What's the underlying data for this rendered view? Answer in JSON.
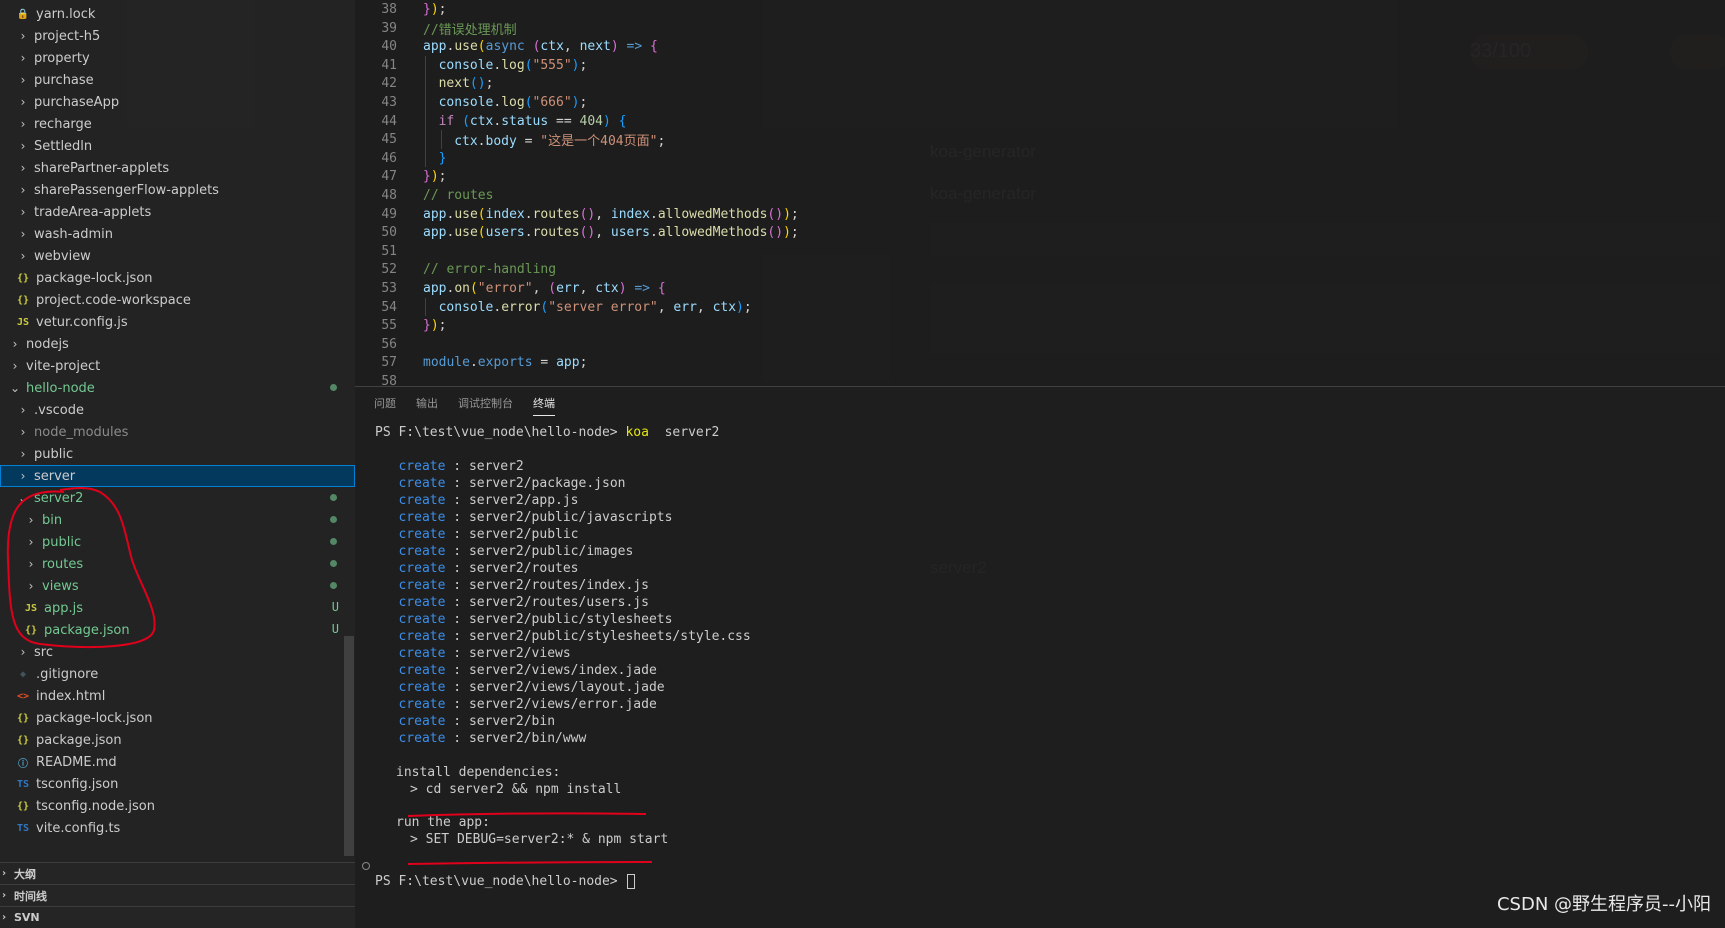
{
  "explorer": {
    "items": [
      {
        "label": "yarn.lock",
        "indent": 1,
        "kind": "file",
        "icon": "lock-file-icon",
        "glyph": "🔒",
        "cls": "",
        "status": ""
      },
      {
        "label": "project-h5",
        "indent": 1,
        "kind": "folder",
        "cls": "",
        "status": ""
      },
      {
        "label": "property",
        "indent": 1,
        "kind": "folder",
        "cls": "",
        "status": ""
      },
      {
        "label": "purchase",
        "indent": 1,
        "kind": "folder",
        "cls": "",
        "status": ""
      },
      {
        "label": "purchaseApp",
        "indent": 1,
        "kind": "folder",
        "cls": "",
        "status": ""
      },
      {
        "label": "recharge",
        "indent": 1,
        "kind": "folder",
        "cls": "",
        "status": ""
      },
      {
        "label": "Settledln",
        "indent": 1,
        "kind": "folder",
        "cls": "",
        "status": ""
      },
      {
        "label": "sharePartner-applets",
        "indent": 1,
        "kind": "folder",
        "cls": "",
        "status": ""
      },
      {
        "label": "sharePassengerFlow-applets",
        "indent": 1,
        "kind": "folder",
        "cls": "",
        "status": ""
      },
      {
        "label": "tradeArea-applets",
        "indent": 1,
        "kind": "folder",
        "cls": "",
        "status": ""
      },
      {
        "label": "wash-admin",
        "indent": 1,
        "kind": "folder",
        "cls": "",
        "status": ""
      },
      {
        "label": "webview",
        "indent": 1,
        "kind": "folder",
        "cls": "",
        "status": ""
      },
      {
        "label": "package-lock.json",
        "indent": 1,
        "kind": "file",
        "icon": "json-file-icon",
        "glyph": "{}",
        "cls": "",
        "status": ""
      },
      {
        "label": "project.code-workspace",
        "indent": 1,
        "kind": "file",
        "icon": "json-file-icon",
        "glyph": "{}",
        "cls": "",
        "status": ""
      },
      {
        "label": "vetur.config.js",
        "indent": 1,
        "kind": "file",
        "icon": "js-file-icon",
        "glyph": "JS",
        "cls": "",
        "status": ""
      },
      {
        "label": "nodejs",
        "indent": 0,
        "kind": "folder",
        "cls": "",
        "status": ""
      },
      {
        "label": "vite-project",
        "indent": 0,
        "kind": "folder",
        "cls": "",
        "status": ""
      },
      {
        "label": "hello-node",
        "indent": 0,
        "kind": "folder-open",
        "cls": "green",
        "status": "dot"
      },
      {
        "label": ".vscode",
        "indent": 1,
        "kind": "folder",
        "cls": "",
        "status": ""
      },
      {
        "label": "node_modules",
        "indent": 1,
        "kind": "folder",
        "cls": "dim",
        "status": ""
      },
      {
        "label": "public",
        "indent": 1,
        "kind": "folder",
        "cls": "",
        "status": ""
      },
      {
        "label": "server",
        "indent": 1,
        "kind": "folder",
        "cls": "selected",
        "status": ""
      },
      {
        "label": "server2",
        "indent": 1,
        "kind": "folder-open",
        "cls": "green",
        "status": "dot"
      },
      {
        "label": "bin",
        "indent": 2,
        "kind": "folder",
        "cls": "green",
        "status": "dot"
      },
      {
        "label": "public",
        "indent": 2,
        "kind": "folder",
        "cls": "green",
        "status": "dot"
      },
      {
        "label": "routes",
        "indent": 2,
        "kind": "folder",
        "cls": "green",
        "status": "dot"
      },
      {
        "label": "views",
        "indent": 2,
        "kind": "folder",
        "cls": "green",
        "status": "dot"
      },
      {
        "label": "app.js",
        "indent": 2,
        "kind": "file",
        "icon": "js-file-icon",
        "glyph": "JS",
        "cls": "green",
        "status": "U"
      },
      {
        "label": "package.json",
        "indent": 2,
        "kind": "file",
        "icon": "json-file-icon",
        "glyph": "{}",
        "cls": "green",
        "status": "U"
      },
      {
        "label": "src",
        "indent": 1,
        "kind": "folder",
        "cls": "",
        "status": ""
      },
      {
        "label": ".gitignore",
        "indent": 1,
        "kind": "file",
        "icon": "git-file-icon",
        "glyph": "◆",
        "cls": "",
        "status": ""
      },
      {
        "label": "index.html",
        "indent": 1,
        "kind": "file",
        "icon": "html-file-icon",
        "glyph": "<>",
        "cls": "",
        "status": ""
      },
      {
        "label": "package-lock.json",
        "indent": 1,
        "kind": "file",
        "icon": "json-file-icon",
        "glyph": "{}",
        "cls": "",
        "status": ""
      },
      {
        "label": "package.json",
        "indent": 1,
        "kind": "file",
        "icon": "json-file-icon",
        "glyph": "{}",
        "cls": "",
        "status": ""
      },
      {
        "label": "README.md",
        "indent": 1,
        "kind": "file",
        "icon": "info-file-icon",
        "glyph": "ⓘ",
        "cls": "",
        "status": ""
      },
      {
        "label": "tsconfig.json",
        "indent": 1,
        "kind": "file",
        "icon": "tsconfig-file-icon",
        "glyph": "TS",
        "cls": "",
        "status": ""
      },
      {
        "label": "tsconfig.node.json",
        "indent": 1,
        "kind": "file",
        "icon": "json-file-icon",
        "glyph": "{}",
        "cls": "",
        "status": ""
      },
      {
        "label": "vite.config.ts",
        "indent": 1,
        "kind": "file",
        "icon": "ts-file-icon",
        "glyph": "TS",
        "cls": "",
        "status": ""
      }
    ],
    "status_untracked": "U",
    "panels": [
      "大纲",
      "时间线",
      "SVN"
    ]
  },
  "editor": {
    "lines": [
      {
        "n": "38",
        "indent": 0,
        "tokens": [
          [
            "tk-br2",
            "}"
          ],
          [
            "tk-br1",
            ")"
          ],
          [
            "tk-pun",
            ";"
          ]
        ]
      },
      {
        "n": "39",
        "indent": 0,
        "tokens": [
          [
            "tk-com",
            "//错误处理机制"
          ]
        ]
      },
      {
        "n": "40",
        "indent": 0,
        "tokens": [
          [
            "tk-var",
            "app"
          ],
          [
            "tk-pun",
            "."
          ],
          [
            "tk-fn",
            "use"
          ],
          [
            "tk-br1",
            "("
          ],
          [
            "tk-kw",
            "async "
          ],
          [
            "tk-br2",
            "("
          ],
          [
            "tk-var",
            "ctx"
          ],
          [
            "tk-pun",
            ", "
          ],
          [
            "tk-var",
            "next"
          ],
          [
            "tk-br2",
            ")"
          ],
          [
            "tk-kw",
            " => "
          ],
          [
            "tk-br2",
            "{"
          ]
        ]
      },
      {
        "n": "41",
        "indent": 1,
        "tokens": [
          [
            "tk-var",
            "console"
          ],
          [
            "tk-pun",
            "."
          ],
          [
            "tk-fn",
            "log"
          ],
          [
            "tk-br3",
            "("
          ],
          [
            "tk-str",
            "\"555\""
          ],
          [
            "tk-br3",
            ")"
          ],
          [
            "tk-pun",
            ";"
          ]
        ]
      },
      {
        "n": "42",
        "indent": 1,
        "tokens": [
          [
            "tk-fn",
            "next"
          ],
          [
            "tk-br3",
            "()"
          ],
          [
            "tk-pun",
            ";"
          ]
        ]
      },
      {
        "n": "43",
        "indent": 1,
        "tokens": [
          [
            "tk-var",
            "console"
          ],
          [
            "tk-pun",
            "."
          ],
          [
            "tk-fn",
            "log"
          ],
          [
            "tk-br3",
            "("
          ],
          [
            "tk-str",
            "\"666\""
          ],
          [
            "tk-br3",
            ")"
          ],
          [
            "tk-pun",
            ";"
          ]
        ]
      },
      {
        "n": "44",
        "indent": 1,
        "tokens": [
          [
            "tk-ctl",
            "if "
          ],
          [
            "tk-br3",
            "("
          ],
          [
            "tk-var",
            "ctx"
          ],
          [
            "tk-pun",
            "."
          ],
          [
            "tk-var",
            "status"
          ],
          [
            "tk-pun",
            " == "
          ],
          [
            "tk-num",
            "404"
          ],
          [
            "tk-br3",
            ")"
          ],
          [
            "tk-pun",
            " "
          ],
          [
            "tk-br3",
            "{"
          ]
        ]
      },
      {
        "n": "45",
        "indent": 2,
        "tokens": [
          [
            "tk-var",
            "ctx"
          ],
          [
            "tk-pun",
            "."
          ],
          [
            "tk-var",
            "body"
          ],
          [
            "tk-pun",
            " = "
          ],
          [
            "tk-str",
            "\"这是一个404页面\""
          ],
          [
            "tk-pun",
            ";"
          ]
        ]
      },
      {
        "n": "46",
        "indent": 1,
        "tokens": [
          [
            "tk-br3",
            "}"
          ]
        ]
      },
      {
        "n": "47",
        "indent": 0,
        "tokens": [
          [
            "tk-br2",
            "}"
          ],
          [
            "tk-br1",
            ")"
          ],
          [
            "tk-pun",
            ";"
          ]
        ]
      },
      {
        "n": "48",
        "indent": 0,
        "tokens": [
          [
            "tk-com",
            "// routes"
          ]
        ]
      },
      {
        "n": "49",
        "indent": 0,
        "tokens": [
          [
            "tk-var",
            "app"
          ],
          [
            "tk-pun",
            "."
          ],
          [
            "tk-fn",
            "use"
          ],
          [
            "tk-br1",
            "("
          ],
          [
            "tk-var",
            "index"
          ],
          [
            "tk-pun",
            "."
          ],
          [
            "tk-fn",
            "routes"
          ],
          [
            "tk-br2",
            "()"
          ],
          [
            "tk-pun",
            ", "
          ],
          [
            "tk-var",
            "index"
          ],
          [
            "tk-pun",
            "."
          ],
          [
            "tk-fn",
            "allowedMethods"
          ],
          [
            "tk-br2",
            "()"
          ],
          [
            "tk-br1",
            ")"
          ],
          [
            "tk-pun",
            ";"
          ]
        ]
      },
      {
        "n": "50",
        "indent": 0,
        "tokens": [
          [
            "tk-var",
            "app"
          ],
          [
            "tk-pun",
            "."
          ],
          [
            "tk-fn",
            "use"
          ],
          [
            "tk-br1",
            "("
          ],
          [
            "tk-var",
            "users"
          ],
          [
            "tk-pun",
            "."
          ],
          [
            "tk-fn",
            "routes"
          ],
          [
            "tk-br2",
            "()"
          ],
          [
            "tk-pun",
            ", "
          ],
          [
            "tk-var",
            "users"
          ],
          [
            "tk-pun",
            "."
          ],
          [
            "tk-fn",
            "allowedMethods"
          ],
          [
            "tk-br2",
            "()"
          ],
          [
            "tk-br1",
            ")"
          ],
          [
            "tk-pun",
            ";"
          ]
        ]
      },
      {
        "n": "51",
        "indent": 0,
        "tokens": []
      },
      {
        "n": "52",
        "indent": 0,
        "tokens": [
          [
            "tk-com",
            "// error-handling"
          ]
        ]
      },
      {
        "n": "53",
        "indent": 0,
        "tokens": [
          [
            "tk-var",
            "app"
          ],
          [
            "tk-pun",
            "."
          ],
          [
            "tk-fn",
            "on"
          ],
          [
            "tk-br1",
            "("
          ],
          [
            "tk-str",
            "\"error\""
          ],
          [
            "tk-pun",
            ", "
          ],
          [
            "tk-br2",
            "("
          ],
          [
            "tk-var",
            "err"
          ],
          [
            "tk-pun",
            ", "
          ],
          [
            "tk-var",
            "ctx"
          ],
          [
            "tk-br2",
            ")"
          ],
          [
            "tk-kw",
            " => "
          ],
          [
            "tk-br2",
            "{"
          ]
        ]
      },
      {
        "n": "54",
        "indent": 1,
        "tokens": [
          [
            "tk-var",
            "console"
          ],
          [
            "tk-pun",
            "."
          ],
          [
            "tk-fn",
            "error"
          ],
          [
            "tk-br3",
            "("
          ],
          [
            "tk-str",
            "\"server error\""
          ],
          [
            "tk-pun",
            ", "
          ],
          [
            "tk-var",
            "err"
          ],
          [
            "tk-pun",
            ", "
          ],
          [
            "tk-var",
            "ctx"
          ],
          [
            "tk-br3",
            ")"
          ],
          [
            "tk-pun",
            ";"
          ]
        ]
      },
      {
        "n": "55",
        "indent": 0,
        "tokens": [
          [
            "tk-br2",
            "}"
          ],
          [
            "tk-br1",
            ")"
          ],
          [
            "tk-pun",
            ";"
          ]
        ]
      },
      {
        "n": "56",
        "indent": 0,
        "tokens": []
      },
      {
        "n": "57",
        "indent": 0,
        "tokens": [
          [
            "tk-kw",
            "module"
          ],
          [
            "tk-pun",
            "."
          ],
          [
            "tk-kw",
            "exports"
          ],
          [
            "tk-pun",
            " = "
          ],
          [
            "tk-var",
            "app"
          ],
          [
            "tk-pun",
            ";"
          ]
        ]
      },
      {
        "n": "58",
        "indent": 0,
        "tokens": []
      }
    ]
  },
  "terminal": {
    "tabs": [
      {
        "label": "问题",
        "active": false
      },
      {
        "label": "输出",
        "active": false
      },
      {
        "label": "调试控制台",
        "active": false
      },
      {
        "label": "终端",
        "active": true
      }
    ],
    "prompt1": "PS F:\\test\\vue_node\\hello-node> ",
    "cmd1": "koa",
    "cmd1_arg": "  server2",
    "create_word": "create",
    "creates": [
      "server2",
      "server2/package.json",
      "server2/app.js",
      "server2/public/javascripts",
      "server2/public",
      "server2/public/images",
      "server2/routes",
      "server2/routes/index.js",
      "server2/routes/users.js",
      "server2/public/stylesheets",
      "server2/public/stylesheets/style.css",
      "server2/views",
      "server2/views/index.jade",
      "server2/views/layout.jade",
      "server2/views/error.jade",
      "server2/bin",
      "server2/bin/www"
    ],
    "install_title": "install dependencies:",
    "install_cmd": "> cd server2 && npm install",
    "run_title": "run the app:",
    "run_cmd": "> SET DEBUG=server2:* & npm start",
    "prompt2": "PS F:\\test\\vue_node\\hello-node> "
  },
  "watermark": "CSDN @野生程序员--小阳",
  "colors": {
    "annotation_red": "#e0001b",
    "git_untracked_green": "#73c991",
    "selection_blue": "#04395e",
    "terminal_create_blue": "#3b8eea"
  }
}
